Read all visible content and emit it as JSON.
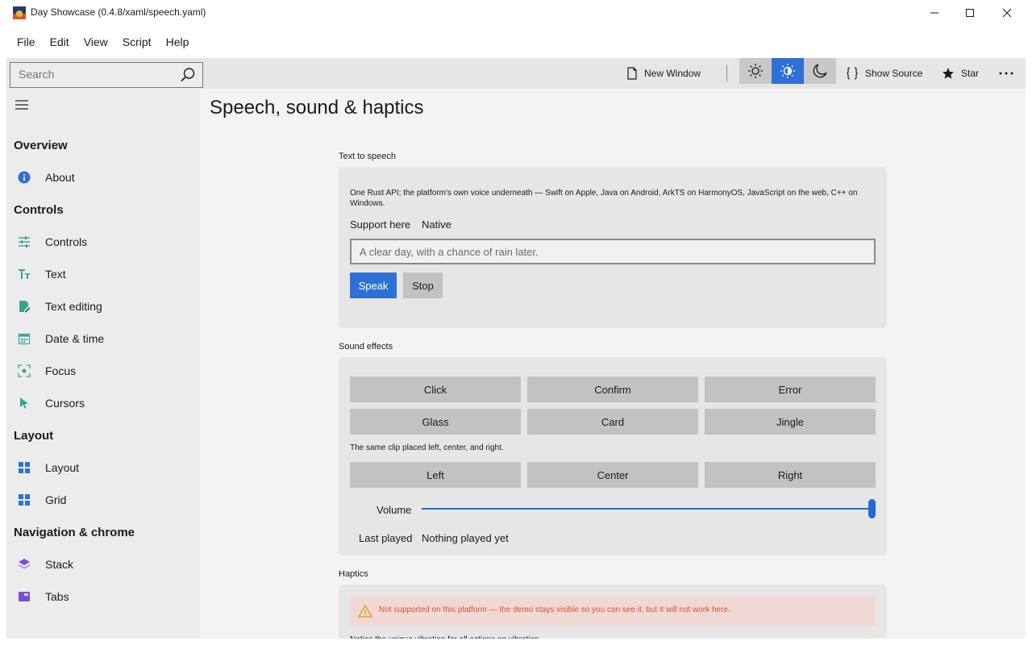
{
  "window": {
    "title": "Day Showcase (0.4.8/xaml/speech.yaml)"
  },
  "menu": [
    "File",
    "Edit",
    "View",
    "Script",
    "Help"
  ],
  "toolbar": {
    "search_placeholder": "Search",
    "new_window": "New Window",
    "show_source": "Show Source",
    "star": "Star"
  },
  "sidebar": {
    "groups": {
      "overview": "Overview",
      "controls": "Controls",
      "layout": "Layout",
      "navigation": "Navigation & chrome"
    },
    "items": {
      "about": "About",
      "controls": "Controls",
      "text": "Text",
      "text_editing": "Text editing",
      "date_time": "Date & time",
      "focus": "Focus",
      "cursors": "Cursors",
      "layout": "Layout",
      "grid": "Grid",
      "stack": "Stack",
      "tabs": "Tabs"
    }
  },
  "page": {
    "title": "Speech, sound & haptics"
  },
  "tts": {
    "section": "Text to speech",
    "description": "One Rust API; the platform's own voice underneath — Swift on Apple, Java on Android, ArkTS on HarmonyOS, JavaScript on the web, C++ on Windows.",
    "support_label": "Support here",
    "support_value": "Native",
    "input_placeholder": "A clear day, with a chance of rain later.",
    "speak": "Speak",
    "stop": "Stop"
  },
  "sfx": {
    "section": "Sound effects",
    "buttons": [
      "Click",
      "Confirm",
      "Error",
      "Glass",
      "Card",
      "Jingle"
    ],
    "pan_note": "The same clip placed left, center, and right.",
    "pan_buttons": [
      "Left",
      "Center",
      "Right"
    ],
    "volume_label": "Volume",
    "volume_value": 1.0,
    "last_played_label": "Last played",
    "last_played_value": "Nothing played yet"
  },
  "haptics": {
    "section": "Haptics",
    "warning": "Not supported on this platform — the demo stays visible so you can see it, but it will not work here.",
    "note_partial": "Notice the unique vibration for all actions on vibration."
  },
  "colors": {
    "accent": "#2f70d6",
    "warning_text": "#d9532c",
    "warning_bg": "#f0d8d4"
  }
}
